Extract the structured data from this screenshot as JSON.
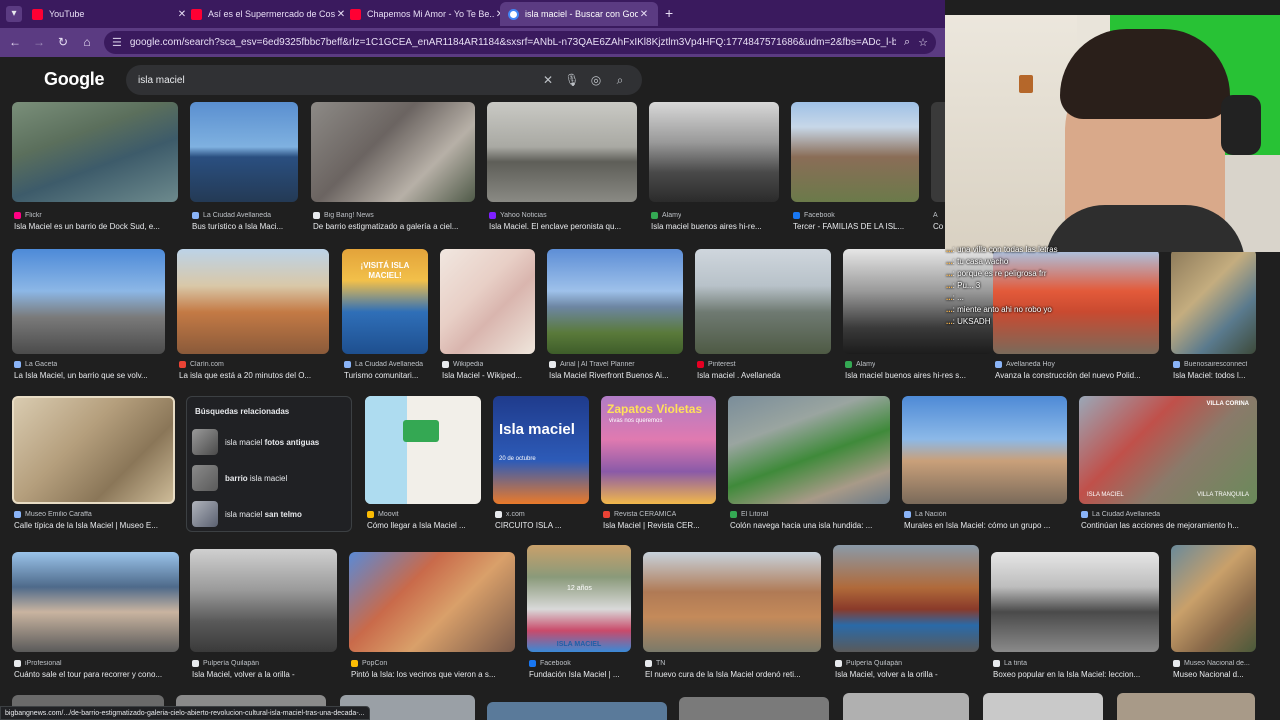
{
  "browser": {
    "tabs": [
      {
        "title": "YouTube",
        "favicon": "youtube-icon",
        "active": false
      },
      {
        "title": "Así es el Supermercado de Cos...",
        "favicon": "youtube-icon",
        "active": false
      },
      {
        "title": "Chapemos Mi Amor - Yo Te Be...",
        "favicon": "youtube-icon",
        "active": false
      },
      {
        "title": "isla maciel - Buscar con Google",
        "favicon": "google-icon",
        "active": true
      }
    ],
    "url": "google.com/search?sca_esv=6ed9325fbbc7beff&rlz=1C1GCEA_enAR1184AR1184&sxsrf=ANbL-n73QAE6ZAhFxIKl8Kjztlm3Vp4HFQ:1774847571686&udm=2&fbs=ADc_l-bpk8W4E-qsVlOvb...",
    "theme_color": "#5b3b82"
  },
  "search": {
    "logo": "Google",
    "query": "isla maciel"
  },
  "rows": [
    [
      {
        "source": "Flickr",
        "caption": "Isla Maciel es un barrio de Dock Sud, e..."
      },
      {
        "source": "La Ciudad Avellaneda",
        "caption": "Bus turístico a Isla Maci..."
      },
      {
        "source": "Big Bang! News",
        "caption": "De barrio estigmatizado a galería a ciel..."
      },
      {
        "source": "Yahoo Noticias",
        "caption": "Isla Maciel. El enclave peronista qu..."
      },
      {
        "source": "Alamy",
        "caption": "Isla maciel buenos aires hi-re..."
      },
      {
        "source": "Facebook",
        "caption": "Tercer - FAMILIAS DE LA ISL..."
      },
      {
        "source": "A",
        "caption": "Co"
      }
    ],
    [
      {
        "source": "La Gaceta",
        "caption": "La Isla Maciel, un barrio que se volv..."
      },
      {
        "source": "Clarín.com",
        "caption": "La isla que está a 20 minutos del O..."
      },
      {
        "source": "La Ciudad Avellaneda",
        "caption": "Turismo comunitari...",
        "overlay": "¡VISITÁ ISLA MACIEL!"
      },
      {
        "source": "Wikipedia",
        "caption": "Isla Maciel - Wikiped..."
      },
      {
        "source": "Airial | AI Travel Planner",
        "caption": "Isla Maciel Riverfront Buenos Ai..."
      },
      {
        "source": "Pinterest",
        "caption": "Isla maciel . Avellaneda"
      },
      {
        "source": "Alamy",
        "caption": "Isla maciel buenos aires hi-res s..."
      },
      {
        "source": "Avellaneda Hoy",
        "caption": "Avanza la construcción del nuevo Polid..."
      },
      {
        "source": "Buenosairesconnect",
        "caption": "Isla Maciel: todos l..."
      }
    ],
    [
      {
        "source": "Museo Emilio Caraffa",
        "caption": "Calle típica de la Isla Maciel | Museo E..."
      },
      {
        "source": "Moovit",
        "caption": "Cómo llegar a Isla Maciel ..."
      },
      {
        "source": "x.com",
        "caption": "CIRCUITO ISLA ...",
        "overlay": "Isla maciel",
        "overlay_sub": "20 de octubre"
      },
      {
        "source": "Revista CERAMICA",
        "caption": "Isla Maciel | Revista CER...",
        "overlay": "Zapatos Violetas",
        "overlay_sub": "vivas nos queremos"
      },
      {
        "source": "El Litoral",
        "caption": "Colón navega hacia una isla hundida: ..."
      },
      {
        "source": "La Nación",
        "caption": "Murales en Isla Maciel: cómo un grupo ..."
      },
      {
        "source": "La Ciudad Avellaneda",
        "caption": "Continúan las acciones de mejoramiento h...",
        "overlay": "VILLA CORINA",
        "overlay_sub": "ISLA MACIEL",
        "overlay_sub2": "VILLA TRANQUILA"
      }
    ],
    [
      {
        "source": "iProfesional",
        "caption": "Cuánto sale el tour para recorrer y cono..."
      },
      {
        "source": "Pulpería Quilapán",
        "caption": "Isla Maciel, volver a la orilla -"
      },
      {
        "source": "PopCon",
        "caption": "Pintó la Isla: los vecinos que vieron a s..."
      },
      {
        "source": "Facebook",
        "caption": "Fundación Isla Maciel | ...",
        "overlay": "ISLA MACIEL",
        "overlay_sub": "12 años"
      },
      {
        "source": "TN",
        "caption": "El nuevo cura de la Isla Maciel ordenó reti..."
      },
      {
        "source": "Pulpería Quilapán",
        "caption": "Isla Maciel, volver a la orilla -"
      },
      {
        "source": "La tinta",
        "caption": "Boxeo popular en la Isla Maciel: leccion..."
      },
      {
        "source": "Museo Nacional de...",
        "caption": "Museo Nacional d..."
      }
    ]
  ],
  "related": {
    "title": "Búsquedas relacionadas",
    "items": [
      {
        "prefix": "isla maciel ",
        "bold": "fotos antiguas",
        "suffix": ""
      },
      {
        "prefix": "",
        "bold": "barrio",
        "suffix": " isla maciel"
      },
      {
        "prefix": "isla maciel ",
        "bold": "san telmo",
        "suffix": ""
      }
    ]
  },
  "status_url": "bigbangnews.com/.../de-barrio-estigmatizado-galeria-cielo-abierto-revolucion-cultural-isla-maciel-tras-una-decada-...",
  "chat": [
    {
      "user": "...",
      "message": "una villa con todas las letras"
    },
    {
      "user": "...",
      "message": "tu casa wacho"
    },
    {
      "user": "...",
      "message": "porque es re peligrosa frr"
    },
    {
      "user": "...",
      "message": "Pu... 3"
    },
    {
      "user": "...",
      "message": "..."
    },
    {
      "user": "...",
      "message": "miente anto ahi no robo yo"
    },
    {
      "user": "...",
      "message": "UKSADH"
    }
  ]
}
